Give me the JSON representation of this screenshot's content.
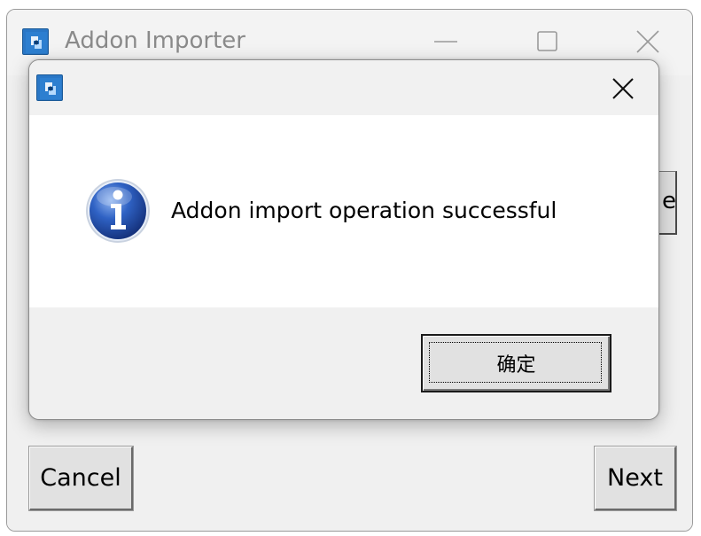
{
  "main_window": {
    "title": "Addon Importer",
    "icon": "app-icon",
    "controls": [
      "minimize-icon",
      "maximize-icon",
      "close-icon"
    ],
    "hidden_button_fragment": "e",
    "cancel_label": "Cancel",
    "next_label": "Next"
  },
  "dialog": {
    "icon": "app-icon",
    "close_icon": "close-icon",
    "message_icon": "info-icon",
    "message": "Addon import operation successful",
    "ok_label": "确定"
  },
  "colors": {
    "window_bg": "#f0f0f0",
    "content_bg": "#ffffff",
    "button_bg": "#e1e1e1",
    "info_icon_blue": "#1f4fa8"
  }
}
